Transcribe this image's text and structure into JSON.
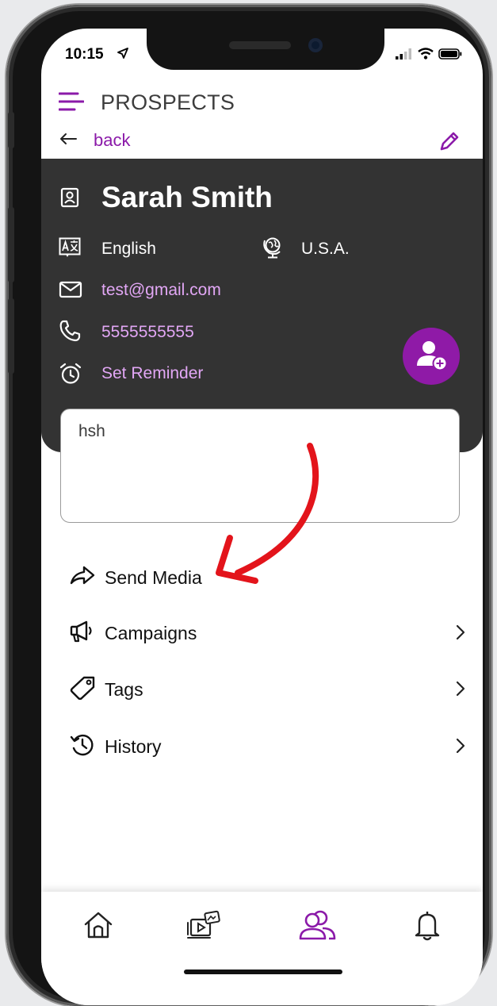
{
  "status_bar": {
    "time": "10:15"
  },
  "header": {
    "title": "PROSPECTS",
    "back_label": "back"
  },
  "contact": {
    "name": "Sarah Smith",
    "language": "English",
    "country": "U.S.A.",
    "email": "test@gmail.com",
    "phone": "5555555555",
    "reminder_label": "Set Reminder"
  },
  "note": {
    "text": "hsh"
  },
  "menu": [
    {
      "label": "Send Media",
      "icon": "share-arrow-icon"
    },
    {
      "label": "Campaigns",
      "icon": "megaphone-icon"
    },
    {
      "label": "Tags",
      "icon": "tag-icon"
    },
    {
      "label": "History",
      "icon": "history-icon"
    }
  ],
  "bottom_nav": [
    {
      "icon": "home-icon"
    },
    {
      "icon": "media-icon"
    },
    {
      "icon": "people-icon",
      "active": true
    },
    {
      "icon": "bell-icon"
    }
  ],
  "colors": {
    "accent": "#8b1aa9",
    "card_bg": "#333333",
    "link_on_dark": "#e2a7f5",
    "annotation_arrow": "#e3141b"
  }
}
